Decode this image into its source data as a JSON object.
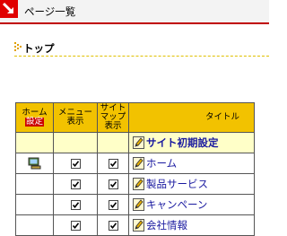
{
  "header": {
    "title": "ページ一覧"
  },
  "section": {
    "title": "トップ"
  },
  "table": {
    "headers": {
      "home_line1": "ホーム",
      "home_line2": "設定",
      "menu_line1": "メニュー",
      "menu_line2": "表示",
      "sitemap_line1": "サイト",
      "sitemap_line2": "マップ",
      "sitemap_line3": "表示",
      "title": "タイトル"
    },
    "rows": [
      {
        "title": "サイト初期設定",
        "home": false,
        "menu": null,
        "sitemap": null
      },
      {
        "title": "ホーム",
        "home": true,
        "menu": true,
        "sitemap": true
      },
      {
        "title": "製品サービス",
        "home": false,
        "menu": true,
        "sitemap": true
      },
      {
        "title": "キャンペーン",
        "home": false,
        "menu": true,
        "sitemap": true
      },
      {
        "title": "会社情報",
        "home": false,
        "menu": true,
        "sitemap": true
      }
    ]
  },
  "icons": {
    "logo": "arrow-down-right-icon",
    "section_marker": "dotted-triangle-icon",
    "edit": "pencil-icon",
    "home_page": "computer-icon"
  },
  "colors": {
    "header_accent": "#c00000",
    "table_header_bg": "#f2c200",
    "top_row_bg": "#ffffc8",
    "link_text": "#1a1aa0"
  }
}
